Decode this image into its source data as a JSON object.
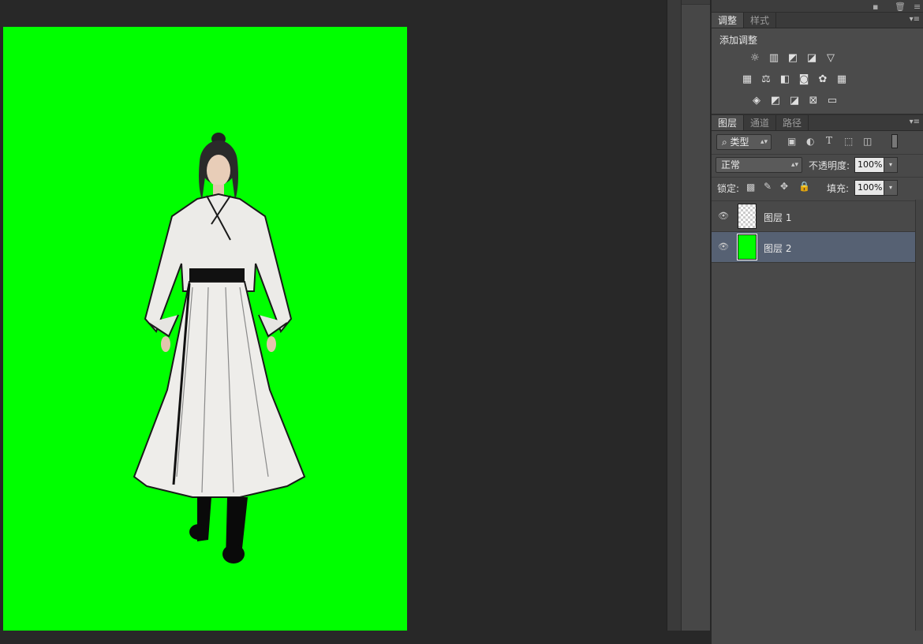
{
  "adjustments_panel": {
    "tabs": [
      "调整",
      "样式"
    ],
    "active_tab": "调整",
    "title": "添加调整",
    "icons_row1": [
      "brightness-icon",
      "levels-icon",
      "curves-icon",
      "exposure-icon",
      "vibrance-icon"
    ],
    "icons_row2": [
      "hue-saturation-icon",
      "color-balance-icon",
      "black-white-icon",
      "photo-filter-icon",
      "channel-mixer-icon",
      "color-lookup-icon"
    ],
    "icons_row3": [
      "invert-icon",
      "posterize-icon",
      "threshold-icon",
      "selective-color-icon",
      "gradient-map-icon"
    ]
  },
  "layers_panel": {
    "tabs": [
      "图层",
      "通道",
      "路径"
    ],
    "active_tab": "图层",
    "filter_kind": "类型",
    "blend_mode": "正常",
    "opacity_label": "不透明度:",
    "opacity_value": "100%",
    "lock_label": "锁定:",
    "fill_label": "填充:",
    "fill_value": "100%",
    "layers": [
      {
        "name": "图层 1",
        "selected": false,
        "thumb": "checker"
      },
      {
        "name": "图层 2",
        "selected": true,
        "thumb": "green"
      }
    ]
  },
  "canvas": {
    "background_color": "#00ff00"
  },
  "colors": {
    "selection": "#566173",
    "panel_bg": "#494949",
    "workspace_bg": "#282828"
  }
}
